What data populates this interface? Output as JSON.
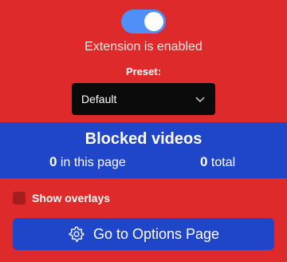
{
  "toggle": {
    "enabled": true,
    "status_text": "Extension is enabled"
  },
  "preset": {
    "label": "Preset:",
    "selected": "Default"
  },
  "blocked": {
    "title": "Blocked videos",
    "in_page_count": "0",
    "in_page_label": "in this page",
    "total_count": "0",
    "total_label": "total"
  },
  "overlays": {
    "label": "Show overlays",
    "checked": false
  },
  "options_button": {
    "label": "Go to Options Page",
    "icon": "gear-icon"
  },
  "colors": {
    "background": "#de2a2a",
    "panel": "#1f45c8",
    "toggle_on": "#4f8ff7",
    "select_bg": "#0b0b0b"
  }
}
